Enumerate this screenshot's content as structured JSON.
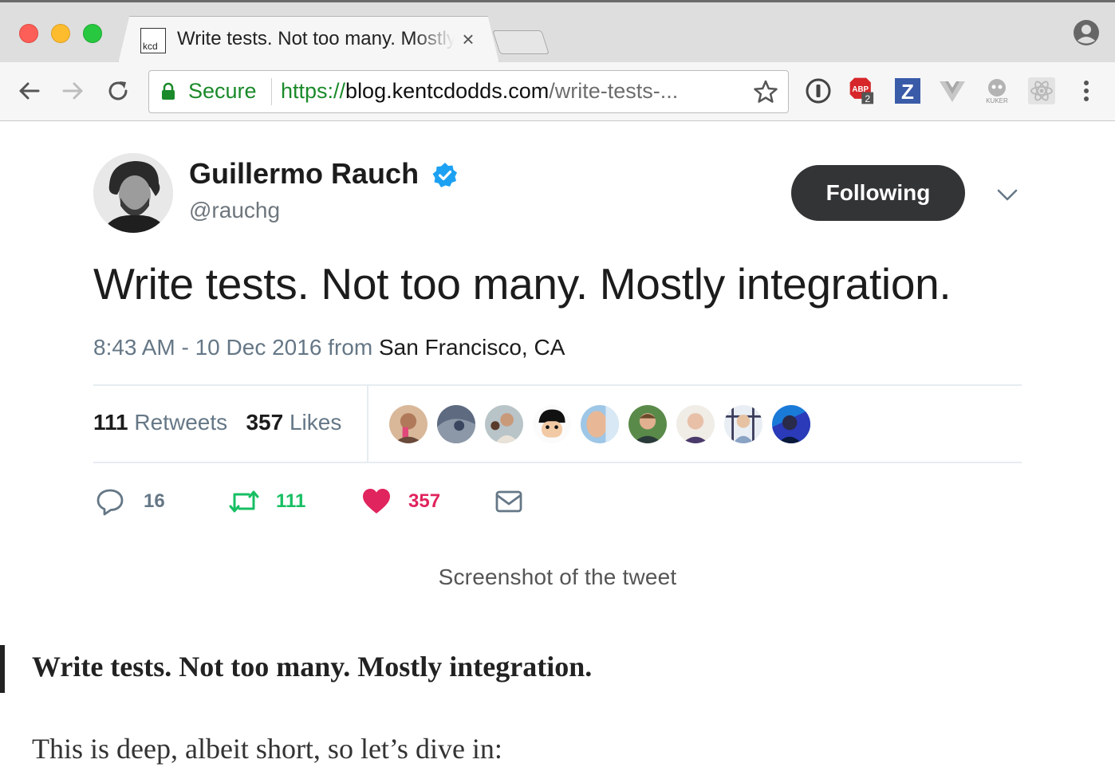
{
  "browser": {
    "tab": {
      "favicon_text": "kcd",
      "title": "Write tests. Not too many. Mostly integration.",
      "close_glyph": "×"
    },
    "omnibox": {
      "secure_label": "Secure",
      "url_scheme": "https://",
      "url_host": "blog.kentcdodds.com",
      "url_path": "/write-tests-..."
    },
    "extensions": [
      {
        "name": "1password-icon"
      },
      {
        "name": "adblock-icon",
        "label": "ABP",
        "badge": "2"
      },
      {
        "name": "zotero-icon",
        "label": "Z"
      },
      {
        "name": "vue-devtools-icon",
        "label": "V"
      },
      {
        "name": "kuker-icon",
        "label": "KUKER"
      },
      {
        "name": "react-devtools-icon"
      }
    ],
    "colors": {
      "secure_green": "#1a8a2a",
      "close_red": "#fc5f57",
      "minimize_yellow": "#fdbc2e",
      "maximize_green": "#28c840"
    }
  },
  "tweet": {
    "author_name": "Guillermo Rauch",
    "author_handle": "@rauchg",
    "follow_label": "Following",
    "text": "Write tests. Not too many. Mostly integration.",
    "timestamp": "8:43 AM - 10 Dec 2016 from ",
    "location": "San Francisco, CA",
    "retweets_count": "111",
    "retweets_label": "Retweets",
    "likes_count": "357",
    "likes_label": "Likes",
    "likers_count": 9,
    "actions": {
      "replies": "16",
      "retweets": "111",
      "likes": "357"
    },
    "colors": {
      "retweet_green": "#17bf63",
      "like_red": "#e0245e",
      "verified_blue": "#1da1f2"
    }
  },
  "article": {
    "caption": "Screenshot of the tweet",
    "blockquote": "Write tests. Not too many. Mostly integration.",
    "paragraph": "This is deep, albeit short, so let’s dive in:"
  }
}
